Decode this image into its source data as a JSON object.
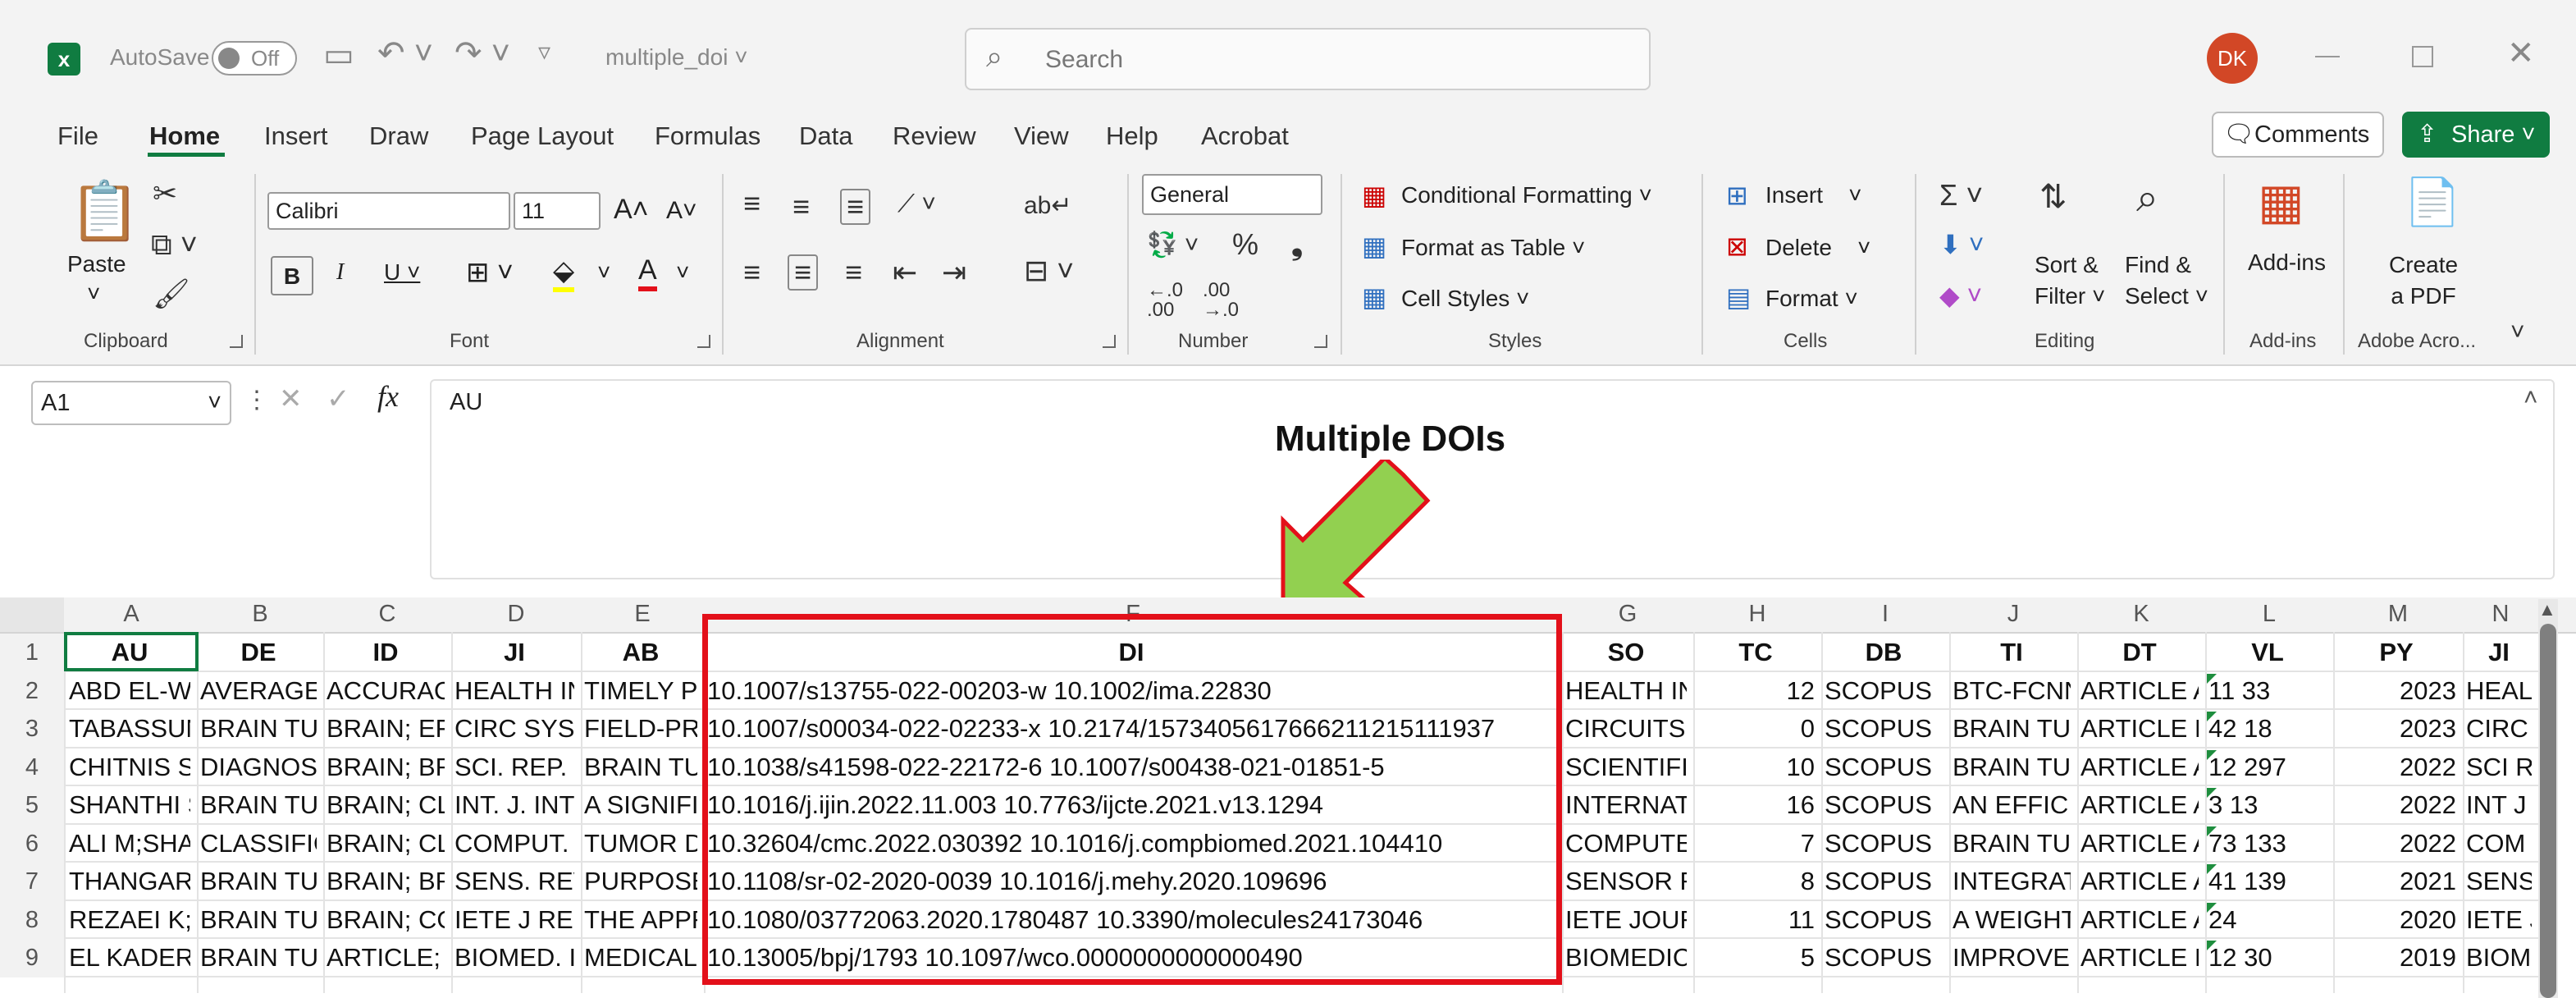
{
  "titlebar": {
    "autosave_label": "AutoSave",
    "autosave_state": "Off",
    "filename": "multiple_doi",
    "search_placeholder": "Search",
    "user_initials": "DK"
  },
  "tabs": [
    "File",
    "Home",
    "Insert",
    "Draw",
    "Page Layout",
    "Formulas",
    "Data",
    "Review",
    "View",
    "Help",
    "Acrobat"
  ],
  "buttons": {
    "comments": "Comments",
    "share": "Share"
  },
  "ribbon": {
    "paste": "Paste",
    "font_name": "Calibri",
    "font_size": "11",
    "number_format": "General",
    "conditional_formatting": "Conditional Formatting",
    "format_as_table": "Format as Table",
    "cell_styles": "Cell Styles",
    "insert": "Insert",
    "delete": "Delete",
    "format": "Format",
    "sort_filter_1": "Sort &",
    "sort_filter_2": "Filter",
    "find_select_1": "Find &",
    "find_select_2": "Select",
    "addins": "Add-ins",
    "create_pdf_1": "Create",
    "create_pdf_2": "a PDF",
    "groups": {
      "clipboard": "Clipboard",
      "font": "Font",
      "alignment": "Alignment",
      "number": "Number",
      "styles": "Styles",
      "cells": "Cells",
      "editing": "Editing",
      "addins": "Add-ins",
      "adobe": "Adobe Acro..."
    }
  },
  "formula_bar": {
    "cell_ref": "A1",
    "content": "AU"
  },
  "annotation": {
    "text": "Multiple DOIs"
  },
  "columns": [
    "A",
    "B",
    "C",
    "D",
    "E",
    "F",
    "G",
    "H",
    "I",
    "J",
    "K",
    "L",
    "M",
    "N"
  ],
  "rows": [
    {
      "n": "1",
      "A": "AU",
      "B": "DE",
      "C": "ID",
      "D": "JI",
      "E": "AB",
      "F": "DI",
      "G": "SO",
      "H": "TC",
      "I": "DB",
      "J": "TI",
      "K": "DT",
      "L": "VL",
      "M": "PY",
      "N": "JI"
    },
    {
      "n": "2",
      "A": "ABD EL-W",
      "B": "AVERAGE",
      "C": "ACCURACY",
      "D": "HEALTH IN",
      "E": "TIMELY PI",
      "F": "10.1007/s13755-022-00203-w 10.1002/ima.22830",
      "G": "HEALTH IN",
      "H": "12",
      "I": "SCOPUS",
      "J": "BTC-FCNN",
      "K": "ARTICLE A",
      "L": "11 33",
      "M": "2023",
      "N": "HEAL"
    },
    {
      "n": "3",
      "A": "TABASSUN",
      "B": "BRAIN TUI",
      "C": "BRAIN; EFI",
      "D": "CIRC SYST",
      "E": "FIELD-PRC",
      "F": "10.1007/s00034-022-02233-x 10.2174/1573405617666211215111937",
      "G": "CIRCUITS,",
      "H": "0",
      "I": "SCOPUS",
      "J": "BRAIN TUI",
      "K": "ARTICLE R",
      "L": "42 18",
      "M": "2023",
      "N": "CIRC"
    },
    {
      "n": "4",
      "A": "CHITNIS S;",
      "B": "DIAGNOSI",
      "C": "BRAIN; BR",
      "D": "SCI. REP. N",
      "E": "BRAIN TU",
      "F": "10.1038/s41598-022-22172-6 10.1007/s00438-021-01851-5",
      "G": "SCIENTIFIC",
      "H": "10",
      "I": "SCOPUS",
      "J": "BRAIN TUI",
      "K": "ARTICLE A",
      "L": "12 297",
      "M": "2022",
      "N": "SCI RI"
    },
    {
      "n": "5",
      "A": "SHANTHI S",
      "B": "BRAIN TUI",
      "C": "BRAIN; CL",
      "D": "INT. J. INT",
      "E": "A SIGNIFIC",
      "F": "10.1016/j.ijin.2022.11.003 10.7763/ijcte.2021.v13.1294",
      "G": "INTERNAT",
      "H": "16",
      "I": "SCOPUS",
      "J": "AN EFFICIE",
      "K": "ARTICLE A",
      "L": "3 13",
      "M": "2022",
      "N": "INT J"
    },
    {
      "n": "6",
      "A": "ALI M;SHA",
      "B": "CLASSIFIC/",
      "C": "BRAIN; CL",
      "D": "COMPUT.",
      "E": "TUMOR DI",
      "F": "10.32604/cmc.2022.030392 10.1016/j.compbiomed.2021.104410",
      "G": "COMPUTE",
      "H": "7",
      "I": "SCOPUS",
      "J": "BRAIN TUI",
      "K": "ARTICLE A",
      "L": "73 133",
      "M": "2022",
      "N": "COM"
    },
    {
      "n": "7",
      "A": "THANGAR",
      "B": "BRAIN TUI",
      "C": "BRAIN; BR",
      "D": "SENS. REV",
      "E": "PURPOSE",
      "F": "10.1108/sr-02-2020-0039 10.1016/j.mehy.2020.109696",
      "G": "SENSOR RI",
      "H": "8",
      "I": "SCOPUS",
      "J": "INTEGRAT",
      "K": "ARTICLE A",
      "L": "41 139",
      "M": "2021",
      "N": "SENS"
    },
    {
      "n": "8",
      "A": "REZAEI K;/",
      "B": "BRAIN TUI",
      "C": "BRAIN; CO",
      "D": "IETE J RES",
      "E": "THE APPR",
      "F": "10.1080/03772063.2020.1780487 10.3390/molecules24173046",
      "G": "IETE JOUR",
      "H": "11",
      "I": "SCOPUS",
      "J": "A WEIGHT",
      "K": "ARTICLE A",
      "L": "24",
      "M": "2020",
      "N": "IETE J"
    },
    {
      "n": "9",
      "A": "EL KADER",
      "B": "BRAIN TUI",
      "C": "ARTICLE; /",
      "D": "BIOMED. I",
      "E": "MEDICAL",
      "F": "10.13005/bpj/1793 10.1097/wco.0000000000000490",
      "G": "BIOMEDIC",
      "H": "5",
      "I": "SCOPUS",
      "J": "IMPROVEI",
      "K": "ARTICLE R",
      "L": "12 30",
      "M": "2019",
      "N": "BIOM"
    }
  ],
  "colors": {
    "accent_green": "#107c41",
    "highlight_red": "#e3101a",
    "arrow_green": "#92d050",
    "avatar": "#d24726"
  }
}
